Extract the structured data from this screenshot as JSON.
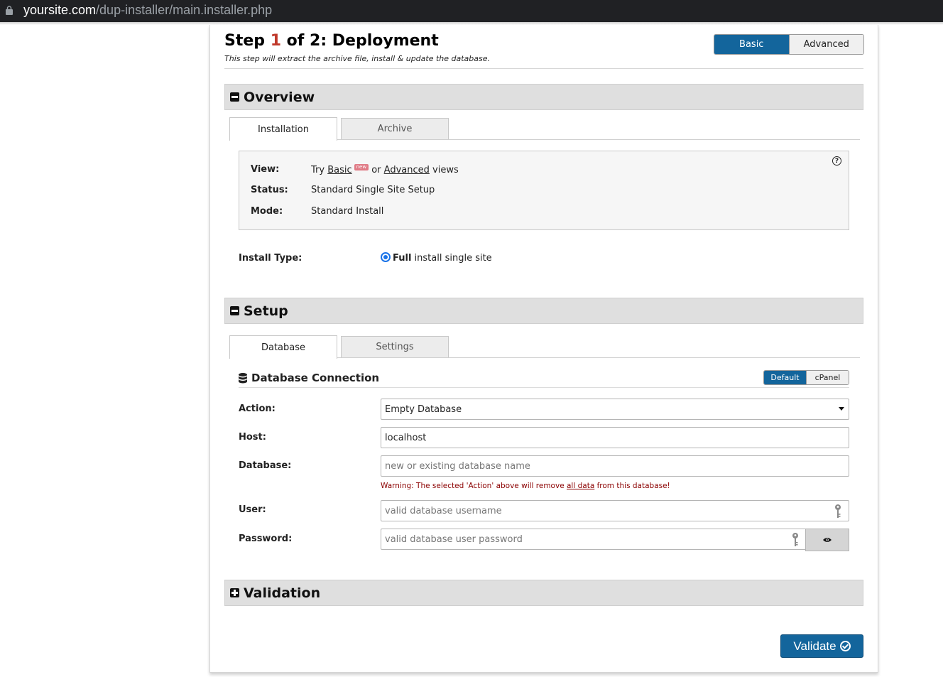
{
  "browser": {
    "url_host": "yoursite.com",
    "url_path": "/dup-installer/main.installer.php"
  },
  "header": {
    "step_prefix": "Step ",
    "step_number": "1",
    "step_suffix": " of 2: Deployment",
    "subtitle": "This step will extract the archive file, install & update the database.",
    "view_basic": "Basic",
    "view_advanced": "Advanced"
  },
  "overview": {
    "title": "Overview",
    "tabs": [
      "Installation",
      "Archive"
    ],
    "view_label": "View:",
    "view_try": "Try ",
    "view_basic_link": "Basic",
    "view_new_badge": "new",
    "view_or": " or ",
    "view_advanced_link": "Advanced",
    "view_suffix": " views",
    "status_label": "Status:",
    "status_value": "Standard Single Site Setup",
    "mode_label": "Mode:",
    "mode_value": "Standard Install",
    "help": "?"
  },
  "install_type": {
    "label": "Install Type:",
    "option_bold": "Full",
    "option_rest": " install single site",
    "selected": true
  },
  "setup": {
    "title": "Setup",
    "tabs": [
      "Database",
      "Settings"
    ],
    "db_title": "Database Connection",
    "db_mode_default": "Default",
    "db_mode_cpanel": "cPanel",
    "action_label": "Action:",
    "action_value": "Empty Database",
    "host_label": "Host:",
    "host_value": "localhost",
    "database_label": "Database:",
    "database_placeholder": "new or existing database name",
    "warning_prefix": "Warning: The selected 'Action' above will remove ",
    "warning_link": "all data",
    "warning_suffix": " from this database!",
    "user_label": "User:",
    "user_placeholder": "valid database username",
    "password_label": "Password:",
    "password_placeholder": "valid database user password"
  },
  "validation": {
    "title": "Validation",
    "button": "Validate"
  },
  "colors": {
    "accent": "#13659c",
    "step_number": "#c0392b",
    "warning": "#8b0000"
  }
}
